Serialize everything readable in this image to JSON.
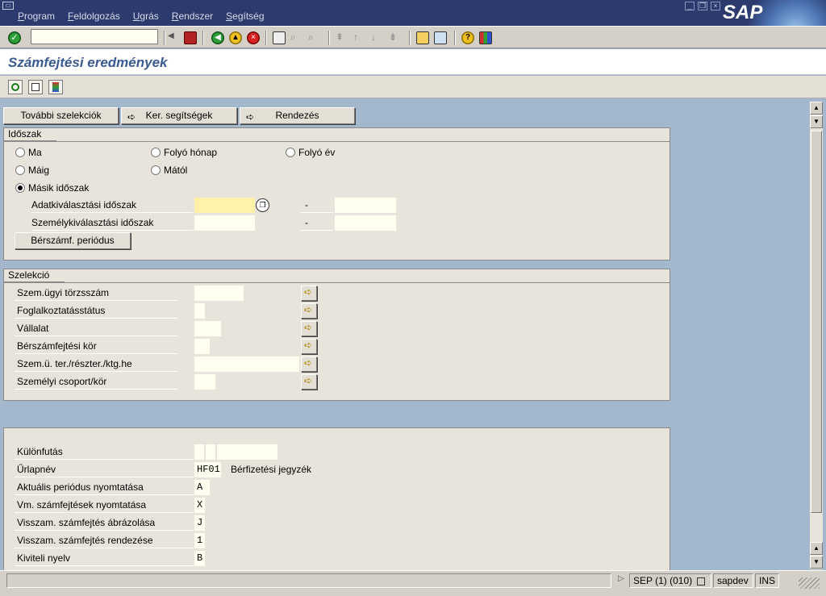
{
  "menu": [
    "Program",
    "Feldolgozás",
    "Ugrás",
    "Rendszer",
    "Segítség"
  ],
  "logo": "SAP",
  "command_field": {
    "value": ""
  },
  "page_title": "Számfejtési eredmények",
  "buttons": {
    "more_selections": "További szelekciók",
    "search_helps": "Ker. segítségek",
    "sort": "Rendezés"
  },
  "period": {
    "title": "Időszak",
    "options": [
      {
        "label": "Ma",
        "selected": false
      },
      {
        "label": "Folyó hónap",
        "selected": false
      },
      {
        "label": "Folyó év",
        "selected": false
      },
      {
        "label": "Máig",
        "selected": false
      },
      {
        "label": "Mától",
        "selected": false
      },
      {
        "label": "Másik időszak",
        "selected": true
      }
    ],
    "data_selection_label": "Adatkiválasztási időszak",
    "person_selection_label": "Személykiválasztási időszak",
    "dash": "-",
    "payroll_period_button": "Bérszámf. periódus"
  },
  "selection": {
    "title": "Szelekció",
    "rows": [
      {
        "label": "Szem.ügyi törzsszám",
        "value": ""
      },
      {
        "label": "Foglalkoztatásstátus",
        "value": ""
      },
      {
        "label": "Vállalat",
        "value": ""
      },
      {
        "label": "Bérszámfejtési kör",
        "value": ""
      },
      {
        "label": "Szem.ü. ter./részter./ktg.he",
        "value": ""
      },
      {
        "label": "Személyi csoport/kör",
        "value": ""
      }
    ]
  },
  "output": {
    "rows": [
      {
        "label": "Különfutás",
        "value": ""
      },
      {
        "label": "Űrlapnév",
        "value": "HF01",
        "desc": "Bérfizetési jegyzék"
      },
      {
        "label": "Aktuális periódus nyomtatása",
        "value": "A"
      },
      {
        "label": "Vm. számfejtések nyomtatása",
        "value": "X"
      },
      {
        "label": "Visszam. számfejtés ábrázolása",
        "value": "J"
      },
      {
        "label": "Visszam. számfejtés rendezése",
        "value": "1"
      },
      {
        "label": "Kiviteli nyelv",
        "value": "B"
      }
    ]
  },
  "status": {
    "system": "SEP (1) (010)",
    "server": "sapdev",
    "mode": "INS"
  },
  "colors": {
    "title_bar": "#2c3a6e",
    "page_bg": "#a3b8cc",
    "title_text": "#3a5a92",
    "highlight_field": "#fff1a8"
  }
}
